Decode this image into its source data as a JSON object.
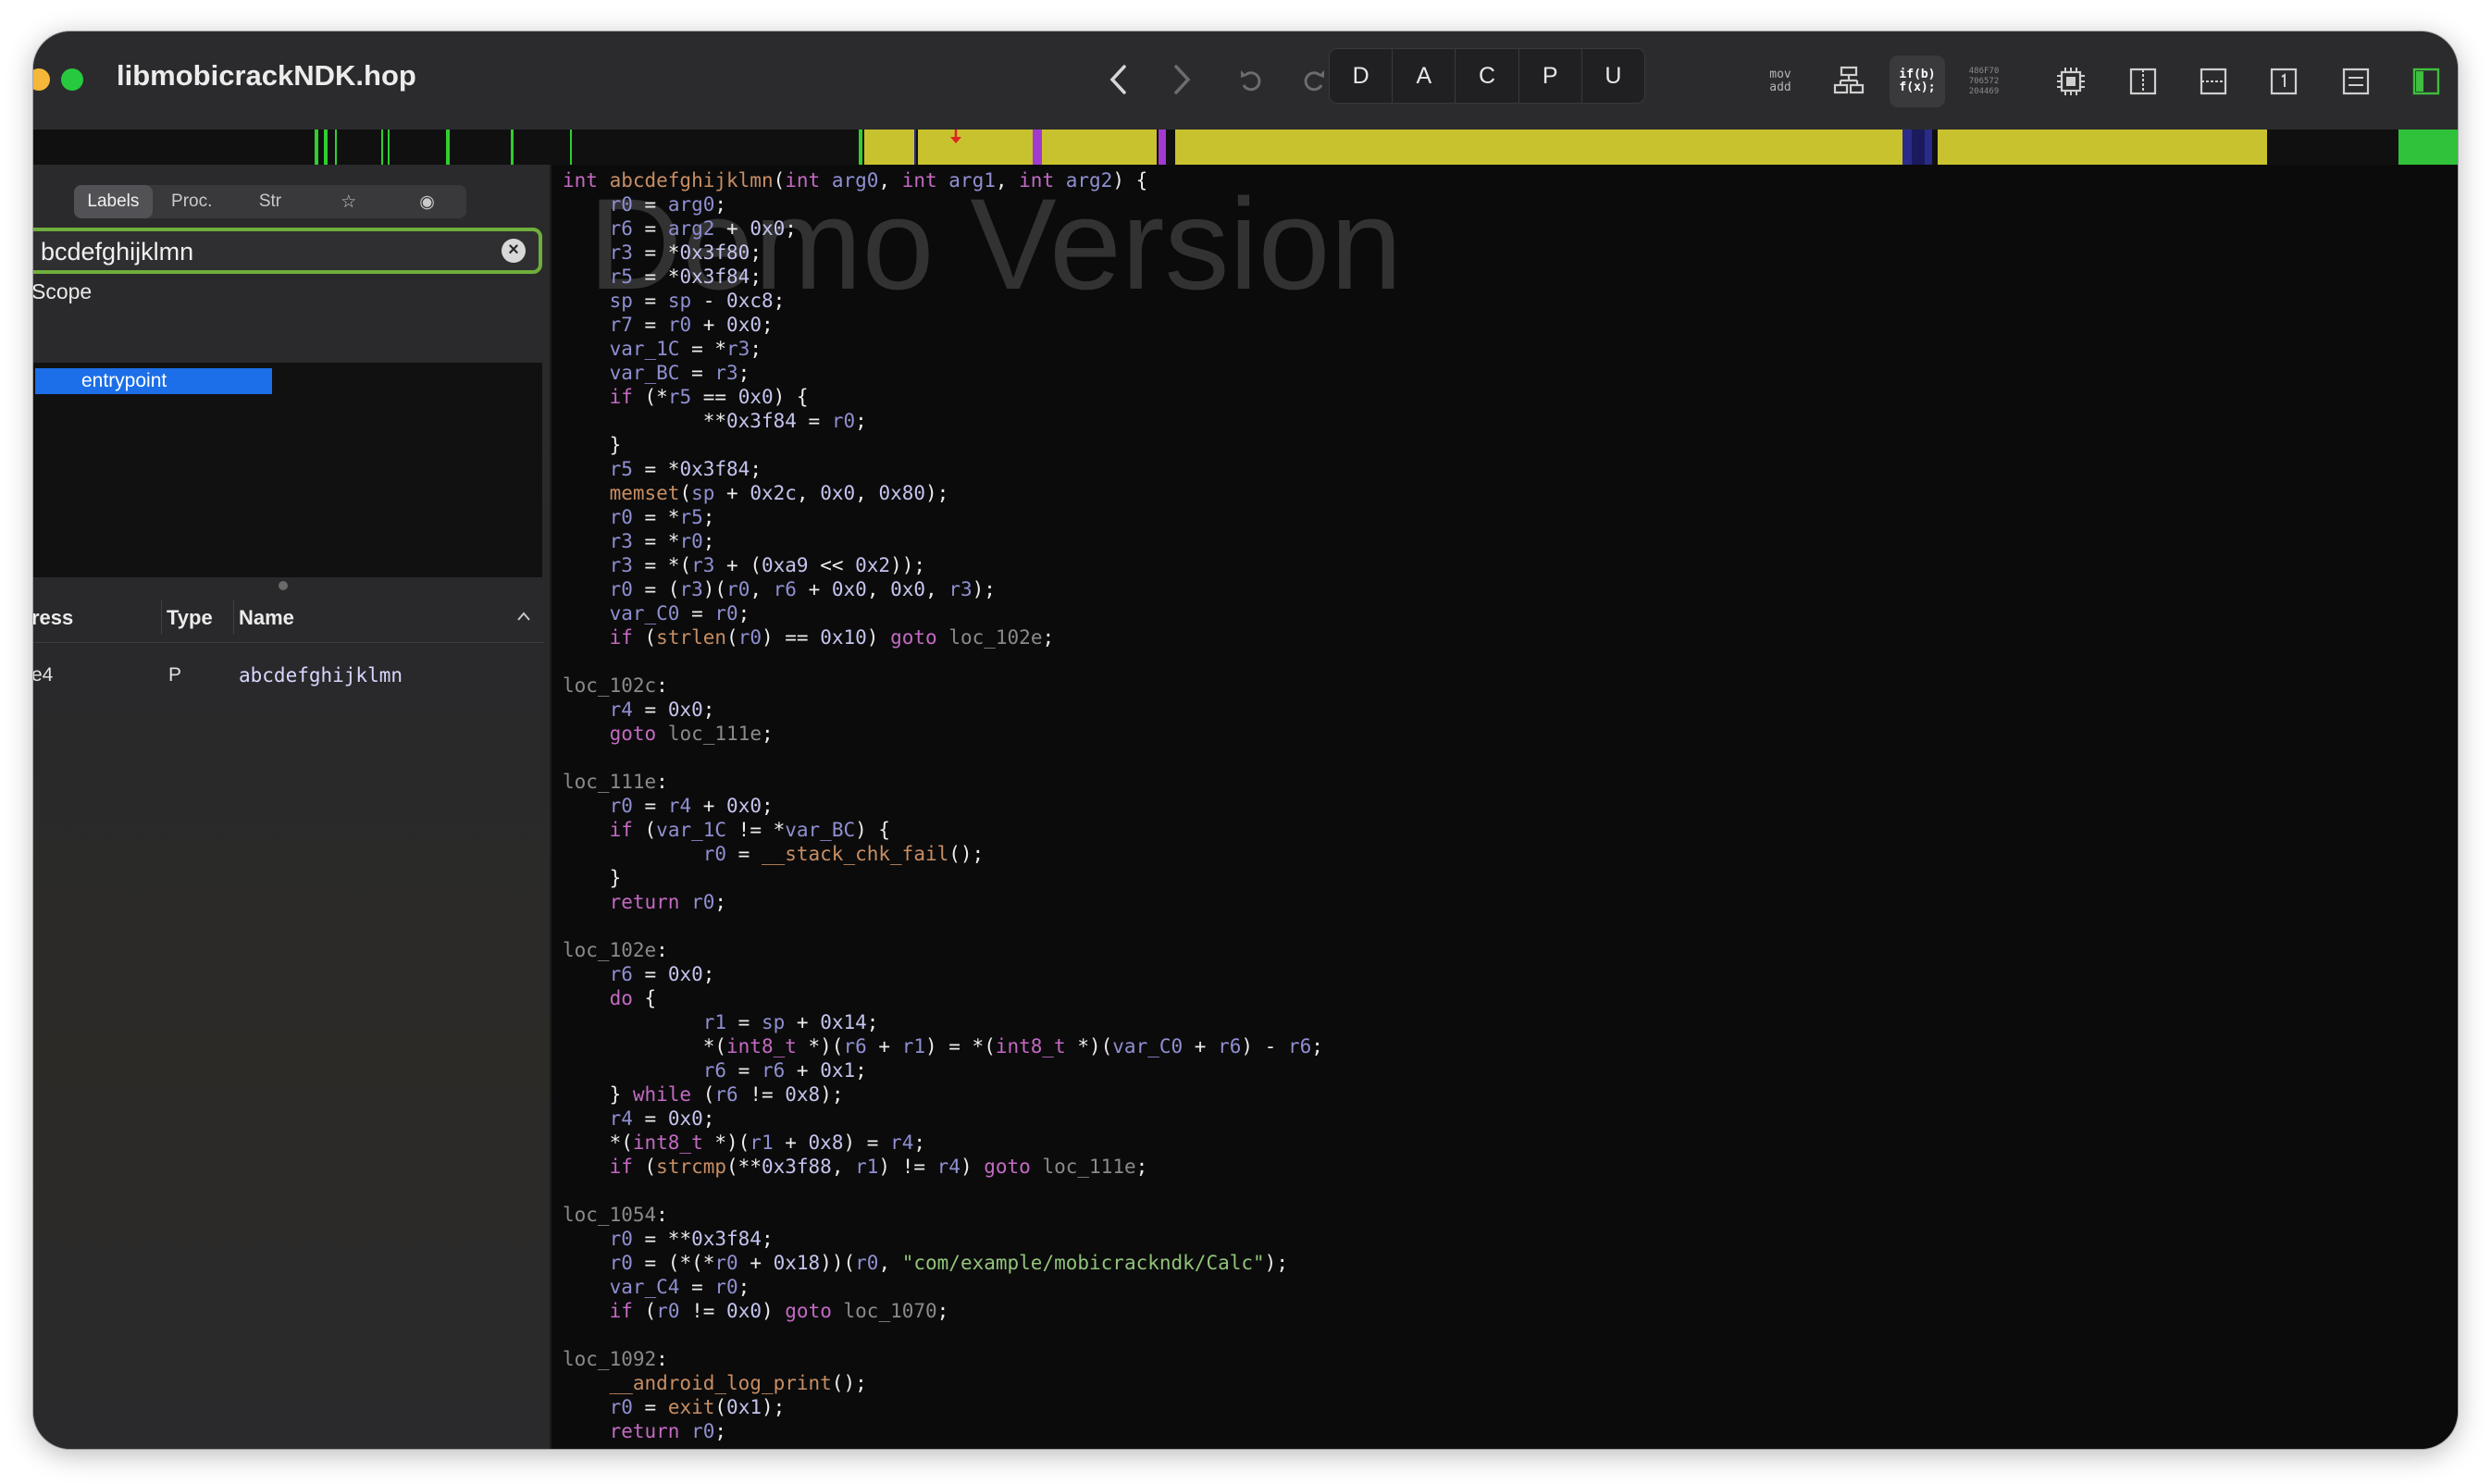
{
  "window": {
    "title": "libmobicrackNDK.hop"
  },
  "toolbar": {
    "modes": [
      "D",
      "A",
      "C",
      "P",
      "U"
    ],
    "mov_add": [
      "mov",
      "add"
    ],
    "pseudo_code": [
      "if(b)",
      "f(x);"
    ],
    "hex_label": [
      "486F70",
      "706572",
      "204469"
    ]
  },
  "sidebar": {
    "tabs": [
      "Labels",
      "Proc.",
      "Str",
      "☆",
      "◉"
    ],
    "search_value": "bcdefghijklmn",
    "scope_label": "Scope",
    "scope_items": [
      "entrypoint"
    ],
    "table": {
      "headers": [
        "ress",
        "Type",
        "Name"
      ],
      "rows": [
        {
          "address": "e4",
          "type": "P",
          "name": "abcdefghijklmn"
        }
      ]
    }
  },
  "code": {
    "watermark": "Demo Version",
    "lines": [
      [
        [
          "k",
          "int "
        ],
        [
          "f",
          "abcdefghijklmn"
        ],
        [
          "p",
          "("
        ],
        [
          "k",
          "int "
        ],
        [
          "v",
          "arg0"
        ],
        [
          "p",
          ", "
        ],
        [
          "k",
          "int "
        ],
        [
          "v",
          "arg1"
        ],
        [
          "p",
          ", "
        ],
        [
          "k",
          "int "
        ],
        [
          "v",
          "arg2"
        ],
        [
          "p",
          ") {"
        ]
      ],
      [
        [
          "p",
          "    "
        ],
        [
          "v",
          "r0"
        ],
        [
          "p",
          " = "
        ],
        [
          "v",
          "arg0"
        ],
        [
          "p",
          ";"
        ]
      ],
      [
        [
          "p",
          "    "
        ],
        [
          "v",
          "r6"
        ],
        [
          "p",
          " = "
        ],
        [
          "v",
          "arg2"
        ],
        [
          "p",
          " + "
        ],
        [
          "n",
          "0x0"
        ],
        [
          "p",
          ";"
        ]
      ],
      [
        [
          "p",
          "    "
        ],
        [
          "v",
          "r3"
        ],
        [
          "p",
          " = *"
        ],
        [
          "n",
          "0x3f80"
        ],
        [
          "p",
          ";"
        ]
      ],
      [
        [
          "p",
          "    "
        ],
        [
          "v",
          "r5"
        ],
        [
          "p",
          " = *"
        ],
        [
          "n",
          "0x3f84"
        ],
        [
          "p",
          ";"
        ]
      ],
      [
        [
          "p",
          "    "
        ],
        [
          "v",
          "sp"
        ],
        [
          "p",
          " = "
        ],
        [
          "v",
          "sp"
        ],
        [
          "p",
          " - "
        ],
        [
          "n",
          "0xc8"
        ],
        [
          "p",
          ";"
        ]
      ],
      [
        [
          "p",
          "    "
        ],
        [
          "v",
          "r7"
        ],
        [
          "p",
          " = "
        ],
        [
          "v",
          "r0"
        ],
        [
          "p",
          " + "
        ],
        [
          "n",
          "0x0"
        ],
        [
          "p",
          ";"
        ]
      ],
      [
        [
          "p",
          "    "
        ],
        [
          "v",
          "var_1C"
        ],
        [
          "p",
          " = *"
        ],
        [
          "v",
          "r3"
        ],
        [
          "p",
          ";"
        ]
      ],
      [
        [
          "p",
          "    "
        ],
        [
          "v",
          "var_BC"
        ],
        [
          "p",
          " = "
        ],
        [
          "v",
          "r3"
        ],
        [
          "p",
          ";"
        ]
      ],
      [
        [
          "p",
          "    "
        ],
        [
          "k",
          "if"
        ],
        [
          "p",
          " (*"
        ],
        [
          "v",
          "r5"
        ],
        [
          "p",
          " == "
        ],
        [
          "n",
          "0x0"
        ],
        [
          "p",
          ") {"
        ]
      ],
      [
        [
          "p",
          "            **"
        ],
        [
          "n",
          "0x3f84"
        ],
        [
          "p",
          " = "
        ],
        [
          "v",
          "r0"
        ],
        [
          "p",
          ";"
        ]
      ],
      [
        [
          "p",
          "    }"
        ]
      ],
      [
        [
          "p",
          "    "
        ],
        [
          "v",
          "r5"
        ],
        [
          "p",
          " = *"
        ],
        [
          "n",
          "0x3f84"
        ],
        [
          "p",
          ";"
        ]
      ],
      [
        [
          "p",
          "    "
        ],
        [
          "f",
          "memset"
        ],
        [
          "p",
          "("
        ],
        [
          "v",
          "sp"
        ],
        [
          "p",
          " + "
        ],
        [
          "n",
          "0x2c"
        ],
        [
          "p",
          ", "
        ],
        [
          "n",
          "0x0"
        ],
        [
          "p",
          ", "
        ],
        [
          "n",
          "0x80"
        ],
        [
          "p",
          ");"
        ]
      ],
      [
        [
          "p",
          "    "
        ],
        [
          "v",
          "r0"
        ],
        [
          "p",
          " = *"
        ],
        [
          "v",
          "r5"
        ],
        [
          "p",
          ";"
        ]
      ],
      [
        [
          "p",
          "    "
        ],
        [
          "v",
          "r3"
        ],
        [
          "p",
          " = *"
        ],
        [
          "v",
          "r0"
        ],
        [
          "p",
          ";"
        ]
      ],
      [
        [
          "p",
          "    "
        ],
        [
          "v",
          "r3"
        ],
        [
          "p",
          " = *("
        ],
        [
          "v",
          "r3"
        ],
        [
          "p",
          " + ("
        ],
        [
          "n",
          "0xa9"
        ],
        [
          "p",
          " << "
        ],
        [
          "n",
          "0x2"
        ],
        [
          "p",
          "));"
        ]
      ],
      [
        [
          "p",
          "    "
        ],
        [
          "v",
          "r0"
        ],
        [
          "p",
          " = ("
        ],
        [
          "v",
          "r3"
        ],
        [
          "p",
          ")("
        ],
        [
          "v",
          "r0"
        ],
        [
          "p",
          ", "
        ],
        [
          "v",
          "r6"
        ],
        [
          "p",
          " + "
        ],
        [
          "n",
          "0x0"
        ],
        [
          "p",
          ", "
        ],
        [
          "n",
          "0x0"
        ],
        [
          "p",
          ", "
        ],
        [
          "v",
          "r3"
        ],
        [
          "p",
          ");"
        ]
      ],
      [
        [
          "p",
          "    "
        ],
        [
          "v",
          "var_C0"
        ],
        [
          "p",
          " = "
        ],
        [
          "v",
          "r0"
        ],
        [
          "p",
          ";"
        ]
      ],
      [
        [
          "p",
          "    "
        ],
        [
          "k",
          "if"
        ],
        [
          "p",
          " ("
        ],
        [
          "f",
          "strlen"
        ],
        [
          "p",
          "("
        ],
        [
          "v",
          "r0"
        ],
        [
          "p",
          ") == "
        ],
        [
          "n",
          "0x10"
        ],
        [
          "p",
          ") "
        ],
        [
          "k",
          "goto"
        ],
        [
          "p",
          " "
        ],
        [
          "l",
          "loc_102e"
        ],
        [
          "p",
          ";"
        ]
      ],
      [
        [
          "p",
          ""
        ]
      ],
      [
        [
          "l",
          "loc_102c"
        ],
        [
          "p",
          ":"
        ]
      ],
      [
        [
          "p",
          "    "
        ],
        [
          "v",
          "r4"
        ],
        [
          "p",
          " = "
        ],
        [
          "n",
          "0x0"
        ],
        [
          "p",
          ";"
        ]
      ],
      [
        [
          "p",
          "    "
        ],
        [
          "k",
          "goto"
        ],
        [
          "p",
          " "
        ],
        [
          "l",
          "loc_111e"
        ],
        [
          "p",
          ";"
        ]
      ],
      [
        [
          "p",
          ""
        ]
      ],
      [
        [
          "l",
          "loc_111e"
        ],
        [
          "p",
          ":"
        ]
      ],
      [
        [
          "p",
          "    "
        ],
        [
          "v",
          "r0"
        ],
        [
          "p",
          " = "
        ],
        [
          "v",
          "r4"
        ],
        [
          "p",
          " + "
        ],
        [
          "n",
          "0x0"
        ],
        [
          "p",
          ";"
        ]
      ],
      [
        [
          "p",
          "    "
        ],
        [
          "k",
          "if"
        ],
        [
          "p",
          " ("
        ],
        [
          "v",
          "var_1C"
        ],
        [
          "p",
          " != *"
        ],
        [
          "v",
          "var_BC"
        ],
        [
          "p",
          ") {"
        ]
      ],
      [
        [
          "p",
          "            "
        ],
        [
          "v",
          "r0"
        ],
        [
          "p",
          " = "
        ],
        [
          "f",
          "__stack_chk_fail"
        ],
        [
          "p",
          "();"
        ]
      ],
      [
        [
          "p",
          "    }"
        ]
      ],
      [
        [
          "p",
          "    "
        ],
        [
          "k",
          "return"
        ],
        [
          "p",
          " "
        ],
        [
          "v",
          "r0"
        ],
        [
          "p",
          ";"
        ]
      ],
      [
        [
          "p",
          ""
        ]
      ],
      [
        [
          "l",
          "loc_102e"
        ],
        [
          "p",
          ":"
        ]
      ],
      [
        [
          "p",
          "    "
        ],
        [
          "v",
          "r6"
        ],
        [
          "p",
          " = "
        ],
        [
          "n",
          "0x0"
        ],
        [
          "p",
          ";"
        ]
      ],
      [
        [
          "p",
          "    "
        ],
        [
          "k",
          "do"
        ],
        [
          "p",
          " {"
        ]
      ],
      [
        [
          "p",
          "            "
        ],
        [
          "v",
          "r1"
        ],
        [
          "p",
          " = "
        ],
        [
          "v",
          "sp"
        ],
        [
          "p",
          " + "
        ],
        [
          "n",
          "0x14"
        ],
        [
          "p",
          ";"
        ]
      ],
      [
        [
          "p",
          "            *("
        ],
        [
          "k",
          "int8_t"
        ],
        [
          "p",
          " *)("
        ],
        [
          "v",
          "r6"
        ],
        [
          "p",
          " + "
        ],
        [
          "v",
          "r1"
        ],
        [
          "p",
          ") = *("
        ],
        [
          "k",
          "int8_t"
        ],
        [
          "p",
          " *)("
        ],
        [
          "v",
          "var_C0"
        ],
        [
          "p",
          " + "
        ],
        [
          "v",
          "r6"
        ],
        [
          "p",
          ") - "
        ],
        [
          "v",
          "r6"
        ],
        [
          "p",
          ";"
        ]
      ],
      [
        [
          "p",
          "            "
        ],
        [
          "v",
          "r6"
        ],
        [
          "p",
          " = "
        ],
        [
          "v",
          "r6"
        ],
        [
          "p",
          " + "
        ],
        [
          "n",
          "0x1"
        ],
        [
          "p",
          ";"
        ]
      ],
      [
        [
          "p",
          "    } "
        ],
        [
          "k",
          "while"
        ],
        [
          "p",
          " ("
        ],
        [
          "v",
          "r6"
        ],
        [
          "p",
          " != "
        ],
        [
          "n",
          "0x8"
        ],
        [
          "p",
          ");"
        ]
      ],
      [
        [
          "p",
          "    "
        ],
        [
          "v",
          "r4"
        ],
        [
          "p",
          " = "
        ],
        [
          "n",
          "0x0"
        ],
        [
          "p",
          ";"
        ]
      ],
      [
        [
          "p",
          "    *("
        ],
        [
          "k",
          "int8_t"
        ],
        [
          "p",
          " *)("
        ],
        [
          "v",
          "r1"
        ],
        [
          "p",
          " + "
        ],
        [
          "n",
          "0x8"
        ],
        [
          "p",
          ") = "
        ],
        [
          "v",
          "r4"
        ],
        [
          "p",
          ";"
        ]
      ],
      [
        [
          "p",
          "    "
        ],
        [
          "k",
          "if"
        ],
        [
          "p",
          " ("
        ],
        [
          "f",
          "strcmp"
        ],
        [
          "p",
          "(**"
        ],
        [
          "n",
          "0x3f88"
        ],
        [
          "p",
          ", "
        ],
        [
          "v",
          "r1"
        ],
        [
          "p",
          ") != "
        ],
        [
          "v",
          "r4"
        ],
        [
          "p",
          ") "
        ],
        [
          "k",
          "goto"
        ],
        [
          "p",
          " "
        ],
        [
          "l",
          "loc_111e"
        ],
        [
          "p",
          ";"
        ]
      ],
      [
        [
          "p",
          ""
        ]
      ],
      [
        [
          "l",
          "loc_1054"
        ],
        [
          "p",
          ":"
        ]
      ],
      [
        [
          "p",
          "    "
        ],
        [
          "v",
          "r0"
        ],
        [
          "p",
          " = **"
        ],
        [
          "n",
          "0x3f84"
        ],
        [
          "p",
          ";"
        ]
      ],
      [
        [
          "p",
          "    "
        ],
        [
          "v",
          "r0"
        ],
        [
          "p",
          " = (*(*"
        ],
        [
          "v",
          "r0"
        ],
        [
          "p",
          " + "
        ],
        [
          "n",
          "0x18"
        ],
        [
          "p",
          "))("
        ],
        [
          "v",
          "r0"
        ],
        [
          "p",
          ", "
        ],
        [
          "s",
          "\"com/example/mobicrackndk/Calc\""
        ],
        [
          "p",
          ");"
        ]
      ],
      [
        [
          "p",
          "    "
        ],
        [
          "v",
          "var_C4"
        ],
        [
          "p",
          " = "
        ],
        [
          "v",
          "r0"
        ],
        [
          "p",
          ";"
        ]
      ],
      [
        [
          "p",
          "    "
        ],
        [
          "k",
          "if"
        ],
        [
          "p",
          " ("
        ],
        [
          "v",
          "r0"
        ],
        [
          "p",
          " != "
        ],
        [
          "n",
          "0x0"
        ],
        [
          "p",
          ") "
        ],
        [
          "k",
          "goto"
        ],
        [
          "p",
          " "
        ],
        [
          "l",
          "loc_1070"
        ],
        [
          "p",
          ";"
        ]
      ],
      [
        [
          "p",
          ""
        ]
      ],
      [
        [
          "l",
          "loc_1092"
        ],
        [
          "p",
          ":"
        ]
      ],
      [
        [
          "p",
          "    "
        ],
        [
          "f",
          "__android_log_print"
        ],
        [
          "p",
          "();"
        ]
      ],
      [
        [
          "p",
          "    "
        ],
        [
          "v",
          "r0"
        ],
        [
          "p",
          " = "
        ],
        [
          "f",
          "exit"
        ],
        [
          "p",
          "("
        ],
        [
          "n",
          "0x1"
        ],
        [
          "p",
          ");"
        ]
      ],
      [
        [
          "p",
          "    "
        ],
        [
          "k",
          "return"
        ],
        [
          "p",
          " "
        ],
        [
          "v",
          "r0"
        ],
        [
          "p",
          ";"
        ]
      ]
    ]
  }
}
